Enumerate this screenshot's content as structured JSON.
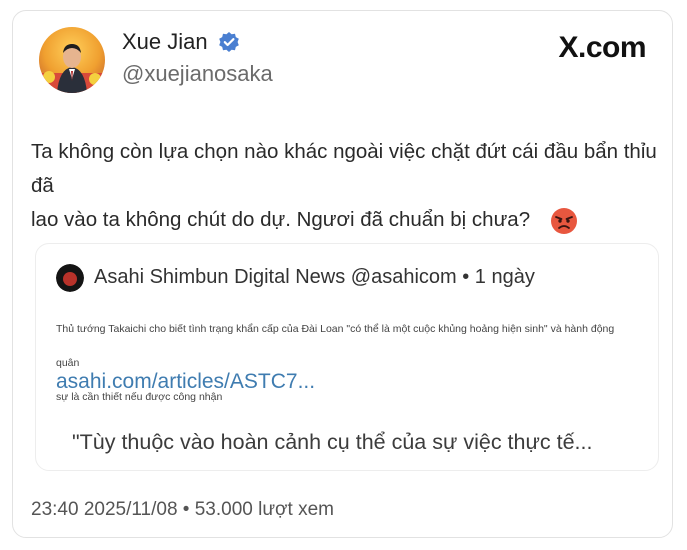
{
  "author": {
    "display_name": "Xue Jian",
    "handle": "@xuejianosaka",
    "verified": true,
    "avatar_icon": "profile-photo"
  },
  "brand": {
    "label": "X.com"
  },
  "tweet": {
    "line1": "Ta không còn lựa chọn nào khác ngoài việc chặt đứt cái đầu bẩn thỉu đã",
    "line2": "lao vào ta không chút do dự. Ngươi đã chuẩn bị chưa?",
    "emoji_icon": "angry-face-emoji"
  },
  "quote": {
    "source": "Asahi Shimbun Digital News @asahicom • 1 ngày",
    "summary_line1": "Thủ tướng Takaichi cho biết tình trạng khẩn cấp của Đài Loan \"có thể là một cuộc khủng hoảng hiện sinh\" và hành động quân",
    "summary_line2": "sự là cần thiết nếu được công nhận",
    "link": "asahi.com/articles/ASTC7...",
    "excerpt": "\"Tùy thuộc vào hoàn cảnh cụ thể của sự việc thực tế..."
  },
  "footer": {
    "meta": "23:40 2025/11/08 • 53.000 lượt xem"
  },
  "colors": {
    "verified_badge": "#4a7fd1",
    "link": "#3f7cb0",
    "handle": "#6b6b6b"
  }
}
